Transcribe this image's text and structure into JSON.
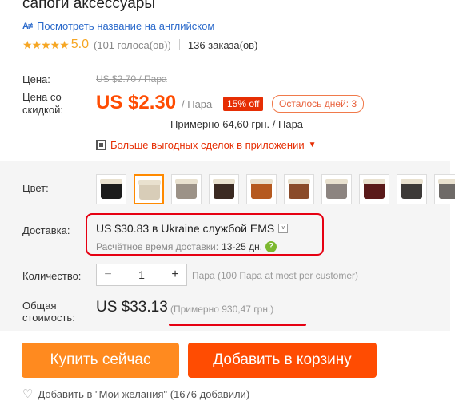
{
  "product": {
    "title": "сапоги аксессуары",
    "translate_link": "Посмотреть название на английском",
    "translate_icon": "translate-icon"
  },
  "rating": {
    "stars": "★★★★★",
    "score": "5.0",
    "votes": "(101 голоса(ов))",
    "orders": "136 заказа(ов)"
  },
  "price": {
    "label": "Цена:",
    "old": "US $2.70 / Пара",
    "discount_label": "Цена со скидкой:",
    "current": "US $2.30",
    "unit": "/ Пара",
    "off_badge": "15% off",
    "days_left": "Осталось дней: 3",
    "approx": "Примерно 64,60 грн. / Пара",
    "app_deals": "Больше выгодных сделок в приложении"
  },
  "color": {
    "label": "Цвет:",
    "swatches": [
      {
        "name": "black",
        "color": "#1c1c1c"
      },
      {
        "name": "beige",
        "color": "#d8cdb8",
        "selected": true
      },
      {
        "name": "gray",
        "color": "#9c9287"
      },
      {
        "name": "coffee",
        "color": "#3b2a22"
      },
      {
        "name": "orange-brown",
        "color": "#b5591f"
      },
      {
        "name": "brown",
        "color": "#8a4b2a"
      },
      {
        "name": "light-gray",
        "color": "#8c8480"
      },
      {
        "name": "wine",
        "color": "#5a1a1a"
      },
      {
        "name": "dark-gray",
        "color": "#3d3a38"
      },
      {
        "name": "gray-pattern",
        "color": "#6e6a67"
      }
    ]
  },
  "shipping": {
    "label": "Доставка:",
    "cost_text": "US $30.83 в Ukraine службой EMS",
    "time_label": "Расчётное время доставки:",
    "time_value": "13-25 дн."
  },
  "quantity": {
    "label": "Количество:",
    "value": "1",
    "minus": "−",
    "plus": "+",
    "note": "Пара (100 Пара at most per customer)"
  },
  "total": {
    "label": "Общая стоимость:",
    "value": "US $33.13",
    "approx": "(Примерно 930,47 грн.)"
  },
  "actions": {
    "buy_now": "Купить сейчас",
    "add_to_cart": "Добавить в корзину"
  },
  "wishlist": {
    "text": "Добавить в \"Мои желания\" (1676 добавили)"
  }
}
